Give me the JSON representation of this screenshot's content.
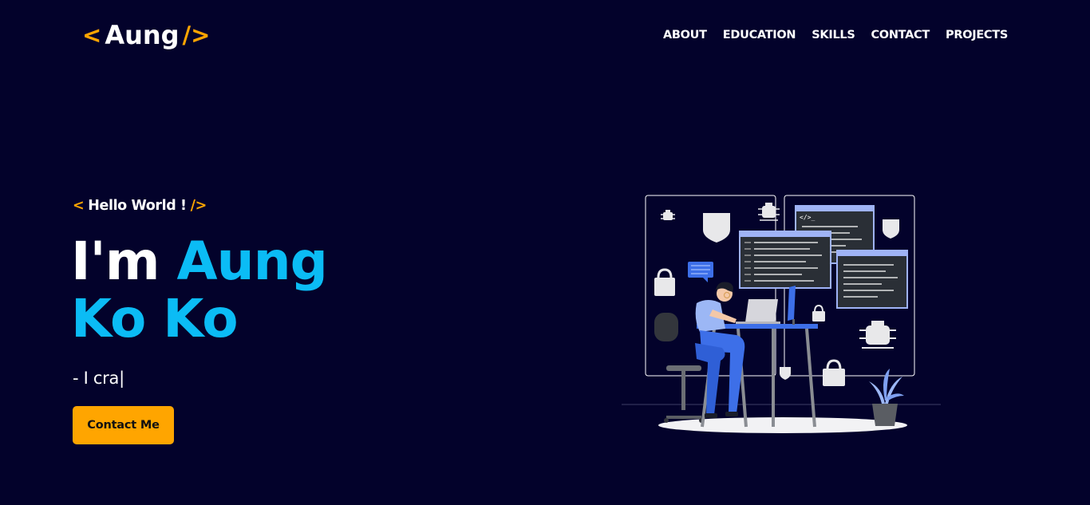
{
  "header": {
    "logo": {
      "open": "<",
      "name": "Aung",
      "close": "/>"
    },
    "nav": [
      {
        "label": "ABOUT"
      },
      {
        "label": "EDUCATION"
      },
      {
        "label": "SKILLS"
      },
      {
        "label": "CONTACT"
      },
      {
        "label": "PROJECTS"
      }
    ]
  },
  "hero": {
    "greeting": {
      "open": "<",
      "text": "Hello World !",
      "close": "/>"
    },
    "headline": {
      "prefix": "I'm",
      "name": "Aung Ko Ko"
    },
    "typed_text": "- I cra",
    "caret": "|",
    "contact_button": "Contact Me"
  },
  "colors": {
    "background": "#03022b",
    "accent": "#ffa500",
    "highlight": "#0bbcf5"
  },
  "illustration": {
    "code_tag": "</>_",
    "icons": [
      "bug-icon",
      "shield-icon",
      "lock-icon",
      "code-window-icon",
      "plant-icon"
    ]
  }
}
